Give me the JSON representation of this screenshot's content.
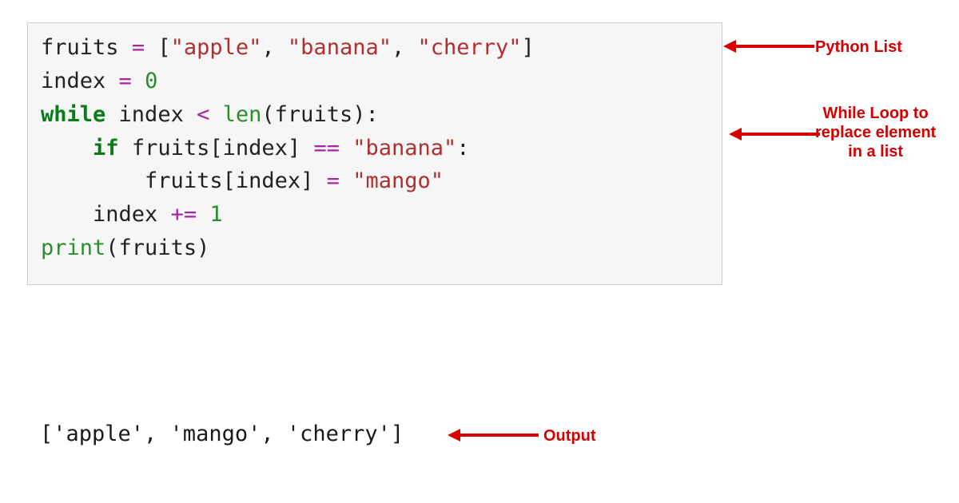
{
  "code": {
    "line1": {
      "var": "fruits",
      "sp": " ",
      "eq": "=",
      "sp2": " ",
      "lb": "[",
      "s1": "\"apple\"",
      "c1": ", ",
      "s2": "\"banana\"",
      "c2": ", ",
      "s3": "\"cherry\"",
      "rb": "]"
    },
    "line2": {
      "var": "index",
      "sp": " ",
      "eq": "=",
      "sp2": " ",
      "num": "0"
    },
    "line3": {
      "kw": "while",
      "sp": " ",
      "var": "index",
      "sp2": " ",
      "lt": "<",
      "sp3": " ",
      "fn": "len",
      "lp": "(",
      "arg": "fruits",
      "rp": ")",
      "col": ":"
    },
    "line4": {
      "indent": "    ",
      "kw": "if",
      "sp": " ",
      "var": "fruits",
      "lb": "[",
      "idx": "index",
      "rb": "]",
      "sp2": " ",
      "eqeq": "==",
      "sp3": " ",
      "str": "\"banana\"",
      "col": ":"
    },
    "line5": {
      "indent": "        ",
      "var": "fruits",
      "lb": "[",
      "idx": "index",
      "rb": "]",
      "sp": " ",
      "eq": "=",
      "sp2": " ",
      "str": "\"mango\""
    },
    "line6": {
      "indent": "    ",
      "var": "index",
      "sp": " ",
      "op": "+=",
      "sp2": " ",
      "num": "1"
    },
    "line7": "",
    "line8": {
      "fn": "print",
      "lp": "(",
      "arg": "fruits",
      "rp": ")"
    }
  },
  "output": "['apple', 'mango', 'cherry']",
  "annotations": {
    "list": "Python List",
    "loop": "While Loop to\nreplace element\nin a list",
    "output": "Output"
  }
}
